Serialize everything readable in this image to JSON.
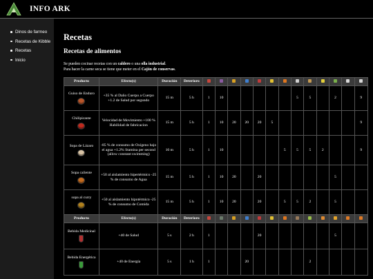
{
  "site": {
    "title": "INFO ARK",
    "logo_icon": "ark-logo-icon",
    "logo_color": "#4a8a3a"
  },
  "sidebar": {
    "items": [
      {
        "label": "Dinos de farmeo"
      },
      {
        "label": "Recetas de Kibble"
      },
      {
        "label": "Recetas"
      },
      {
        "label": "Inicio"
      }
    ]
  },
  "main": {
    "title": "Recetas",
    "section": "Recetas de alimentos",
    "intro": {
      "line1_a": "Se pueden cocinar recetas con un ",
      "line1_b": "caldero",
      "line1_c": " o una ",
      "line1_d": "olla industrial",
      "line1_e": ".",
      "line2_a": "Para hacer la carne seca se tiene que meter en el ",
      "line2_b": "Cajón de conservas",
      "line2_c": "."
    }
  },
  "table": {
    "headers": {
      "producto": "Producto",
      "efectos": "Efecto(s)",
      "duracion": "Duración",
      "deterioro": "Deterioro"
    },
    "ingredient_icons_1": [
      {
        "name": "meat-icon",
        "color": "#c8463c"
      },
      {
        "name": "berries-icon",
        "color": "#8a5aa0"
      },
      {
        "name": "citronal-icon",
        "color": "#d9a021"
      },
      {
        "name": "mejoberry-icon",
        "color": "#3e7fd0"
      },
      {
        "name": "tintoberry-icon",
        "color": "#c03a3a"
      },
      {
        "name": "amarberry-icon",
        "color": "#e2c031"
      },
      {
        "name": "carrot-icon",
        "color": "#e0761e"
      },
      {
        "name": "stimberry-icon",
        "color": "#d0d0d0"
      },
      {
        "name": "potato-icon",
        "color": "#c59a52"
      },
      {
        "name": "corn-icon",
        "color": "#e3cf3a"
      },
      {
        "name": "fiber-icon",
        "color": "#7ab04b"
      },
      {
        "name": "water-icon",
        "color": "#d8d8d8"
      }
    ],
    "ingredient_icons_2": [
      {
        "name": "meat-icon",
        "color": "#c8463c"
      },
      {
        "name": "narcotic-icon",
        "color": "#6b7b6b"
      },
      {
        "name": "citronal-icon",
        "color": "#d9a021"
      },
      {
        "name": "azulberry-icon",
        "color": "#3e7fd0"
      },
      {
        "name": "tintoberry-icon",
        "color": "#c03a3a"
      },
      {
        "name": "amarberry-icon",
        "color": "#e2c031"
      },
      {
        "name": "carrot-icon",
        "color": "#e0761e"
      },
      {
        "name": "stimulant-icon",
        "color": "#9a7a5a"
      },
      {
        "name": "longrass-icon",
        "color": "#9ac04a"
      },
      {
        "name": "rockarrot-icon",
        "color": "#e08a30"
      },
      {
        "name": "honey-icon",
        "color": "#e6a52a"
      },
      {
        "name": "sparkpowder-icon",
        "color": "#e07a25"
      }
    ],
    "food_rows": [
      {
        "producto": "Guiso de Enduro",
        "efectos": "+35 % al Daño Cuerpo a Cuerpo +1.2 de Salud por segundo",
        "duracion": "15 m",
        "deterioro": "5 h",
        "icon": "stew-icon",
        "color": "#b8552a",
        "ing": [
          "1",
          "10",
          "",
          "",
          "",
          "",
          "",
          "5",
          "5",
          "",
          "2",
          "",
          "9"
        ]
      },
      {
        "producto": "Chilipicante",
        "efectos": "Velocidad de Movimiento +100 % Habilidad de fabricacion",
        "duracion": "15 m",
        "deterioro": "5 h",
        "icon": "chili-icon",
        "color": "#c02a1e",
        "ing": [
          "1",
          "10",
          "20",
          "20",
          "20",
          "5",
          "",
          "",
          "",
          "",
          "",
          "",
          "9"
        ]
      },
      {
        "producto": "Sopa de Lázaro",
        "efectos": "-85 % de consumo de Oxígeno bajo el agua +1.2% Stamina per second (allow constant swimming)",
        "duracion": "10 m",
        "deterioro": "5 h",
        "icon": "soup-icon",
        "color": "#d8c3a5",
        "ing": [
          "1",
          "10",
          "",
          "",
          "",
          "",
          "5",
          "5",
          "5",
          "2",
          "",
          "",
          "9"
        ]
      },
      {
        "producto": "Sopa caliente",
        "efectos": "+50 al aislamiento hipertérmico -25 % de consumo de Agua",
        "duracion": "15 m",
        "deterioro": "5 h",
        "icon": "hot-soup-icon",
        "color": "#c26a1f",
        "ing": [
          "1",
          "10",
          "20",
          "",
          "20",
          "",
          "",
          "",
          "",
          "",
          "5",
          "",
          ""
        ]
      },
      {
        "producto": "sopa al curry",
        "efectos": "+50 al aislamiento hipotérmico -25 % de consumo de Comida",
        "duracion": "15 m",
        "deterioro": "5 h",
        "icon": "curry-icon",
        "color": "#b0801c",
        "ing": [
          "1",
          "10",
          "20",
          "",
          "20",
          "",
          "5",
          "5",
          "2",
          "",
          "5",
          "",
          ""
        ]
      }
    ],
    "drink_rows": [
      {
        "producto": "Bebida Medicinal",
        "efectos": "+40 de Salud",
        "duracion": "5 s",
        "deterioro": "2 h",
        "icon": "medical-brew-icon",
        "color": "#b03030",
        "ing": [
          "1",
          "",
          "",
          "",
          "20",
          "",
          "",
          "",
          "",
          "",
          "5",
          "",
          ""
        ]
      },
      {
        "producto": "Bebida Energética",
        "efectos": "+40 de Energía",
        "duracion": "5 s",
        "deterioro": "1 h",
        "icon": "energy-brew-icon",
        "color": "#3a9a3a",
        "ing": [
          "1",
          "",
          "",
          "20",
          "",
          "",
          "",
          "",
          "2",
          "",
          "",
          "",
          ""
        ]
      }
    ]
  }
}
